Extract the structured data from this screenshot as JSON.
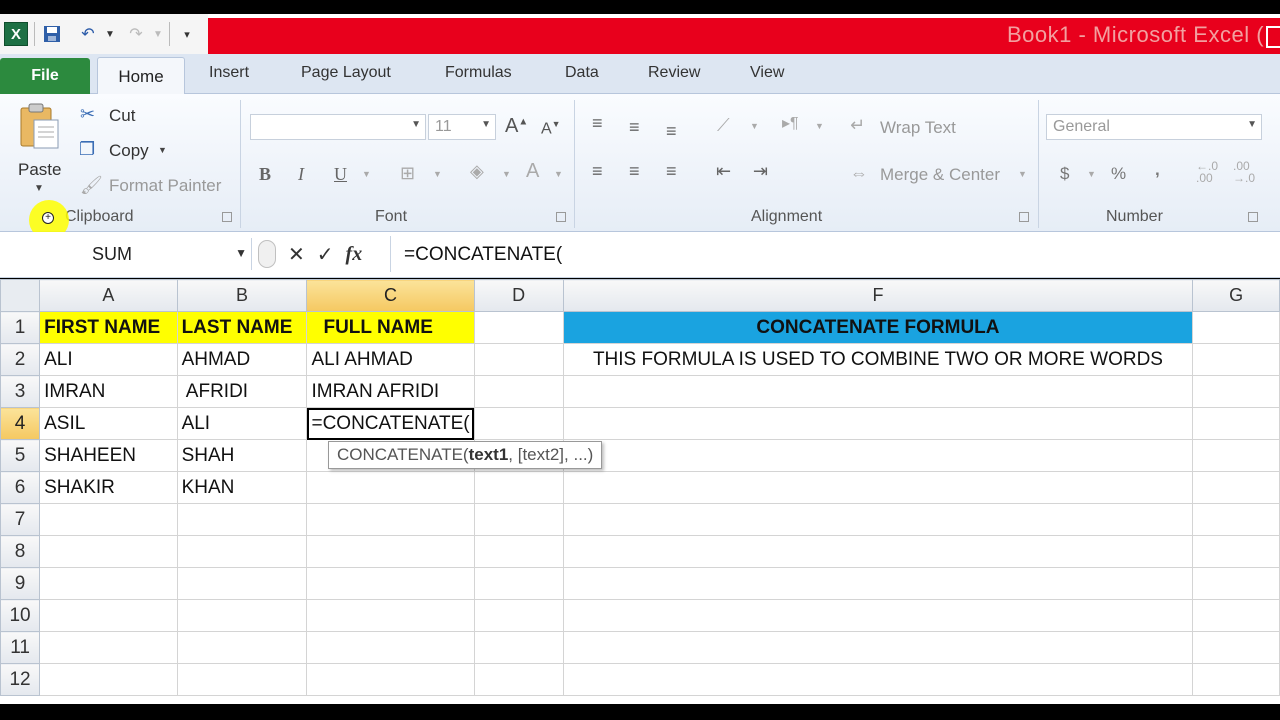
{
  "window": {
    "title": "Book1  -  Microsoft Excel (",
    "app_logo": "X"
  },
  "qat": {
    "save_icon": "save-icon",
    "undo_icon": "undo-icon",
    "redo_icon": "redo-icon"
  },
  "tabs": {
    "file": "File",
    "home": "Home",
    "insert": "Insert",
    "page_layout": "Page Layout",
    "formulas": "Formulas",
    "data": "Data",
    "review": "Review",
    "view": "View"
  },
  "ribbon": {
    "clipboard": {
      "paste": "Paste",
      "cut": "Cut",
      "copy": "Copy",
      "format_painter": "Format Painter",
      "label": "Clipboard"
    },
    "font": {
      "font_name": "",
      "font_size": "11",
      "bold": "B",
      "italic": "I",
      "underline": "U",
      "label": "Font"
    },
    "alignment": {
      "wrap_text": "Wrap Text",
      "merge_center": "Merge & Center",
      "label": "Alignment"
    },
    "number": {
      "format": "General",
      "currency": "$",
      "percent": "%",
      "comma": ",",
      "label": "Number"
    }
  },
  "formula_bar": {
    "name_box": "SUM",
    "cancel": "✕",
    "enter": "✓",
    "fx": "fx",
    "formula": "=CONCATENATE("
  },
  "sheet": {
    "columns": [
      "A",
      "B",
      "C",
      "D",
      "F",
      "G"
    ],
    "rows": [
      "1",
      "2",
      "3",
      "4",
      "5",
      "6",
      "7",
      "8",
      "9",
      "10",
      "11",
      "12"
    ],
    "headers": {
      "first_name": "FIRST NAME",
      "last_name": "LAST NAME",
      "full_name": "FULL NAME",
      "concat_title": "CONCATENATE FORMULA"
    },
    "description": "THIS FORMULA IS USED TO COMBINE TWO OR MORE WORDS",
    "data": [
      {
        "first": "ALI",
        "last": "AHMAD",
        "full": "ALI AHMAD"
      },
      {
        "first": "IMRAN",
        "last": " AFRIDI",
        "full": "IMRAN AFRIDI"
      },
      {
        "first": "ASIL",
        "last": "ALI",
        "full": "=CONCATENATE("
      },
      {
        "first": "SHAHEEN",
        "last": "SHAH",
        "full": ""
      },
      {
        "first": "SHAKIR",
        "last": "KHAN",
        "full": ""
      }
    ],
    "tooltip": {
      "func": "CONCATENATE(",
      "arg1": "text1",
      "rest": ", [text2], ...)"
    }
  },
  "colors": {
    "title_red": "#e8001c",
    "file_green": "#2c8a3e",
    "header_yellow": "#ffff00",
    "header_blue": "#1aa3e0",
    "selected_col_orange": "#f5c861"
  }
}
